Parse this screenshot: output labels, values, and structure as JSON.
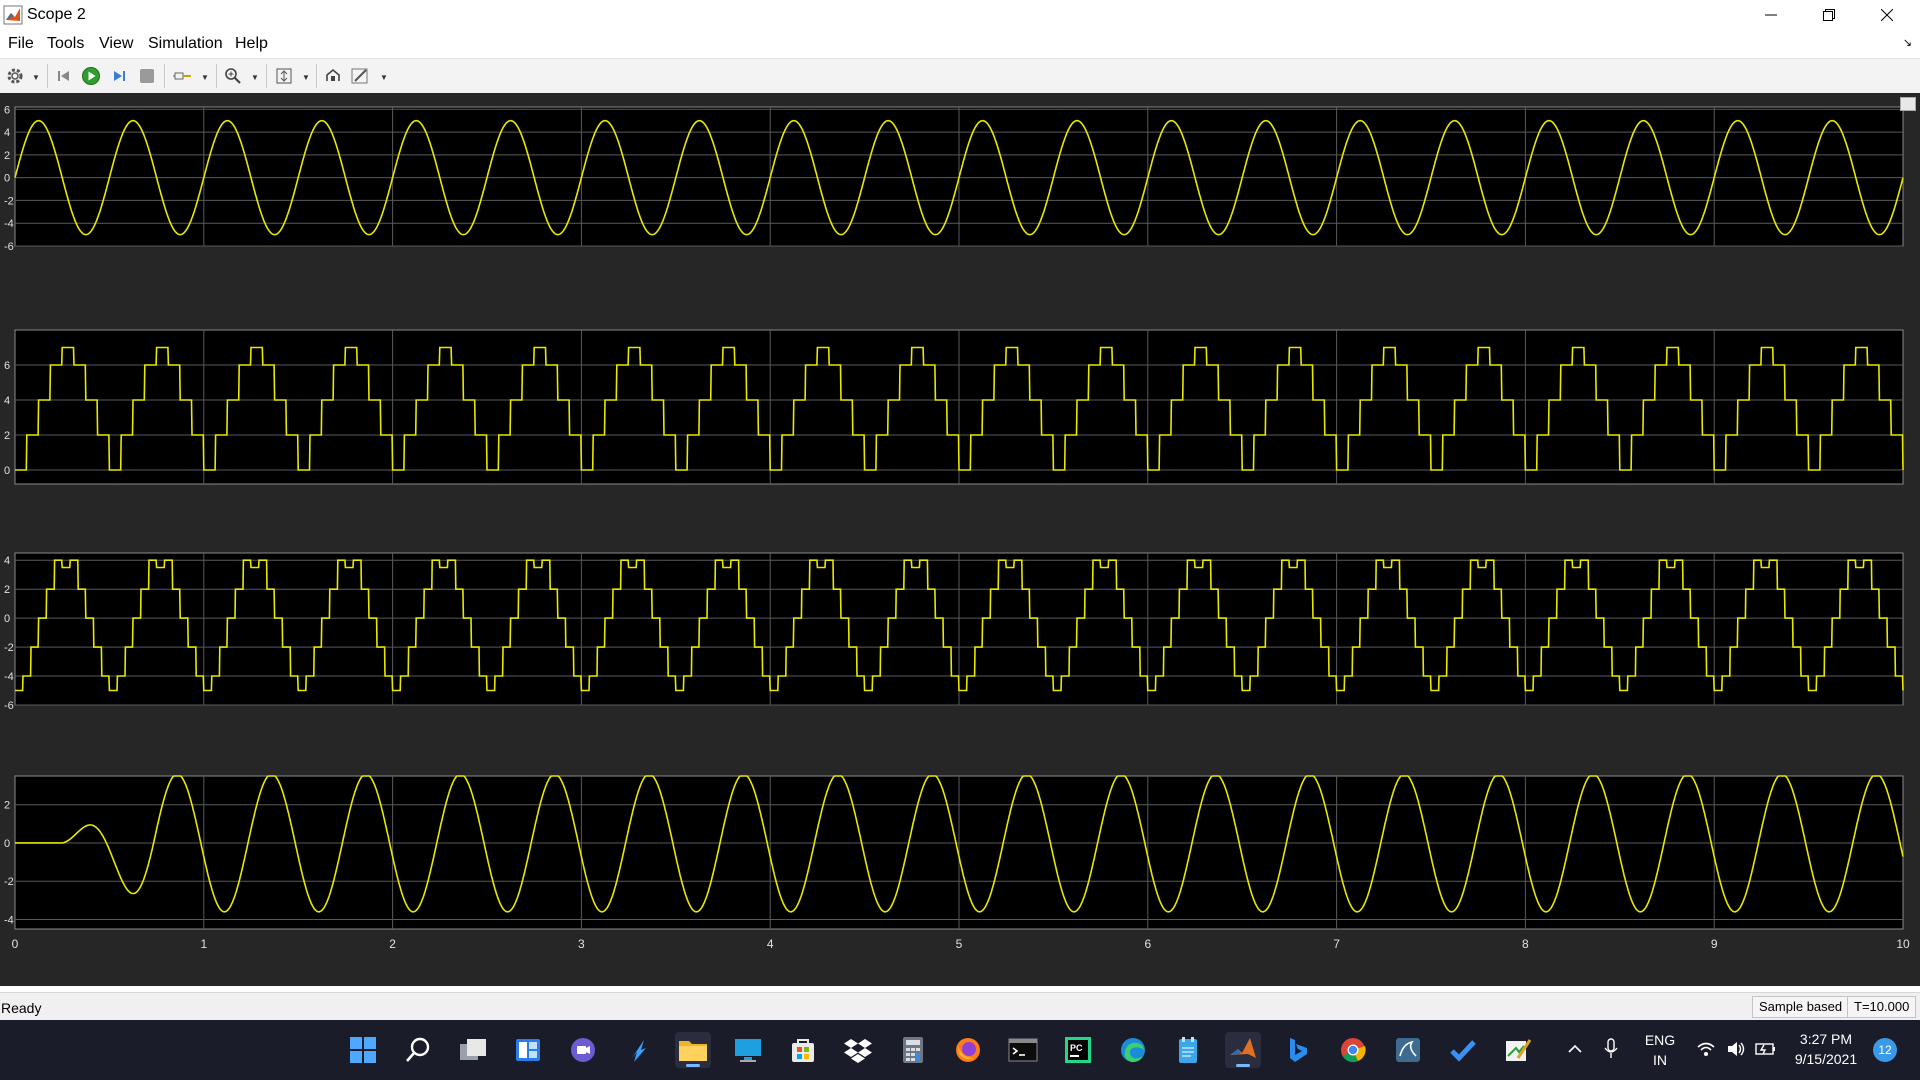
{
  "window": {
    "title": "Scope 2"
  },
  "menu": [
    {
      "label": "File"
    },
    {
      "label": "Tools"
    },
    {
      "label": "View"
    },
    {
      "label": "Simulation"
    },
    {
      "label": "Help"
    }
  ],
  "toolbar": {
    "icons": [
      "gear-icon",
      "step-back-icon",
      "run-icon",
      "step-forward-icon",
      "stop-icon",
      "highlight-signal-icon",
      "zoom-in-icon",
      "scale-axes-icon",
      "restore-view-icon",
      "edit-icon"
    ]
  },
  "colors": {
    "trace": "#e8e800",
    "plot_background": "#000000",
    "scope_background": "#262626",
    "grid": "#5a5a5a"
  },
  "chart_data": [
    {
      "type": "line",
      "title": "",
      "xlabel": "",
      "ylabel": "",
      "xlim": [
        0,
        10
      ],
      "ylim": [
        -6,
        6.2
      ],
      "yticks": [
        6,
        4,
        2,
        0,
        -2,
        -4,
        -6
      ],
      "series": [
        {
          "signal": "sine",
          "amplitude": 5,
          "frequency_hz": 2,
          "offset": 0,
          "x_range": [
            0,
            10
          ]
        }
      ]
    },
    {
      "type": "line",
      "title": "",
      "xlabel": "",
      "ylabel": "",
      "xlim": [
        0,
        10
      ],
      "ylim": [
        -0.8,
        8
      ],
      "yticks": [
        6,
        4,
        2,
        0
      ],
      "series": [
        {
          "signal": "staircase",
          "levels": [
            0,
            2,
            4,
            6,
            7
          ],
          "period": 0.5,
          "x_range": [
            0,
            10
          ]
        }
      ]
    },
    {
      "type": "line",
      "title": "",
      "xlabel": "",
      "ylabel": "",
      "xlim": [
        0,
        10
      ],
      "ylim": [
        -6,
        4.5
      ],
      "yticks": [
        4,
        2,
        0,
        -2,
        -4,
        -6
      ],
      "series": [
        {
          "signal": "staircase",
          "levels": [
            -5,
            -4,
            -2,
            0,
            2,
            4,
            3.5
          ],
          "period": 0.5,
          "x_range": [
            0,
            10
          ]
        }
      ]
    },
    {
      "type": "line",
      "title": "",
      "xlabel": "",
      "ylabel": "",
      "xlim": [
        0,
        10
      ],
      "ylim": [
        -4.5,
        3.5
      ],
      "yticks": [
        2,
        0,
        -2,
        -4
      ],
      "xticks": [
        0,
        1,
        2,
        3,
        4,
        5,
        6,
        7,
        8,
        9,
        10
      ],
      "series": [
        {
          "signal": "sine-with-startup",
          "amplitude": 3.6,
          "frequency_hz": 2,
          "startup_end": 0.25,
          "x_range": [
            0,
            10
          ]
        }
      ]
    }
  ],
  "status": {
    "text": "Ready",
    "sample_mode": "Sample based",
    "time": "T=10.000"
  },
  "taskbar": {
    "apps": [
      "windows-start-icon",
      "search-icon",
      "task-view-icon",
      "widgets-icon",
      "teams-chat-icon",
      "visual-studio-icon",
      "file-explorer-icon",
      "remote-desktop-icon",
      "microsoft-store-icon",
      "dropbox-icon",
      "calculator-icon",
      "firefox-icon",
      "terminal-icon",
      "pycharm-icon",
      "edge-icon",
      "notepad-icon",
      "matlab-icon",
      "bing-icon",
      "chrome-icon",
      "mysql-workbench-icon",
      "todo-icon",
      "draw-icon"
    ],
    "language": "ENG",
    "region": "IN",
    "time": "3:27 PM",
    "date": "9/15/2021",
    "notifications": "12"
  }
}
